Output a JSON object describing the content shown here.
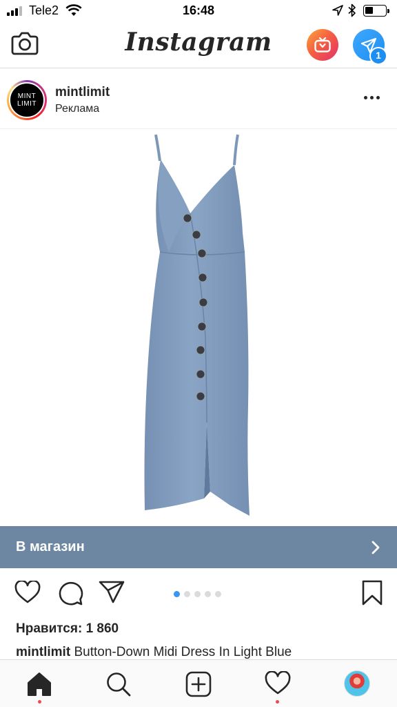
{
  "status_bar": {
    "carrier": "Tele2",
    "time": "16:48",
    "battery_level": 0.4
  },
  "header": {
    "title": "Instagram",
    "left_icon": "camera-icon",
    "right_icons": [
      "igtv-icon",
      "direct-message-icon"
    ],
    "dm_badge": "1"
  },
  "post": {
    "avatar_text": [
      "MINT",
      "LIMIT"
    ],
    "username": "mintlimit",
    "subtitle": "Реклама",
    "menu_icon": "more-options-icon",
    "image_icon": "dress-photo",
    "shop_label": "В магазин",
    "carousel": {
      "count": 5,
      "active": 0
    },
    "likes": "Нравится: 1 860",
    "caption_user": "mintlimit",
    "caption_text": "Button-Down Midi Dress In Light Blue"
  },
  "colors": {
    "accent_blue": "#3897f0",
    "shop_bar": "#6d87a2",
    "notification_red": "#ed4956",
    "text": "#262626"
  },
  "tab_bar": {
    "items": [
      "home-icon",
      "search-icon",
      "new-post-icon",
      "activity-icon",
      "profile-avatar"
    ]
  }
}
